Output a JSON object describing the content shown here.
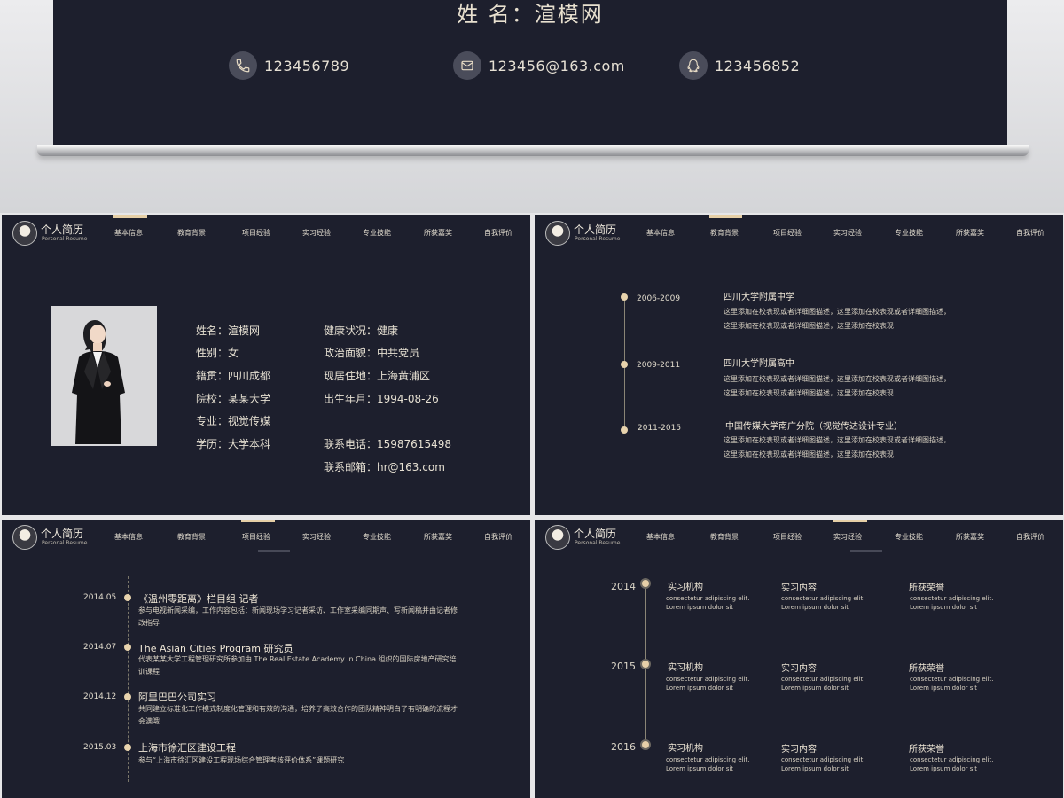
{
  "hero": {
    "name_line": "姓  名：渲模网",
    "phone": "123456789",
    "email": "123456@163.com",
    "qq": "123456852"
  },
  "brand": {
    "title_cn": "个人简历",
    "title_en": "Personal Resume"
  },
  "nav": [
    "基本信息",
    "教育背景",
    "项目经验",
    "实习经验",
    "专业技能",
    "所获嘉奖",
    "自我评价"
  ],
  "basic_info": {
    "left": [
      "姓名：渲模网",
      "性别：女",
      "籍贯：四川成都",
      "院校：某某大学",
      "专业：视觉传媒",
      "学历：大学本科"
    ],
    "right": [
      "健康状况：健康",
      "政治面貌：中共党员",
      "现居住地：上海黄浦区",
      "出生年月：1994-08-26"
    ],
    "phone_label": "联系电话：15987615498",
    "email_label": "联系邮箱：hr@163.com"
  },
  "education": [
    {
      "period": "2006-2009",
      "school": "四川大学附属中学",
      "desc1": "这里添加在校表现或者详细图描述，这里添加在校表现或者详细图描述，",
      "desc2": "这里添加在校表现或者详细图描述，这里添加在校表现"
    },
    {
      "period": "2009-2011",
      "school": "四川大学附属高中",
      "desc1": "这里添加在校表现或者详细图描述，这里添加在校表现或者详细图描述，",
      "desc2": "这里添加在校表现或者详细图描述，这里添加在校表现"
    },
    {
      "period": "2011-2015",
      "school": "中国传媒大学南广分院（视觉传达设计专业）",
      "desc1": "这里添加在校表现或者详细图描述，这里添加在校表现或者详细图描述，",
      "desc2": "这里添加在校表现或者详细图描述，这里添加在校表现"
    }
  ],
  "projects": [
    {
      "date": "2014.05",
      "title": "《温州零距离》栏目组  记者",
      "desc": "参与电视新闻采编，工作内容包括：新闻现场学习记者采访、工作室采编同期声、写新闻稿并由记者修改指导"
    },
    {
      "date": "2014.07",
      "title": "The Asian Cities Program  研究员",
      "desc": "代表某某大学工程管理研究所参加由 The Real Estate Academy in China  组织的国际房地产研究培训课程"
    },
    {
      "date": "2014.12",
      "title": "阿里巴巴公司实习",
      "desc": "共同建立标准化工作模式制度化管理和有效的沟通，培养了高效合作的团队精神明白了有明确的流程才会满哦"
    },
    {
      "date": "2015.03",
      "title": "上海市徐汇区建设工程",
      "desc": "参与“上海市徐汇区建设工程现场综合管理考核评价体系”课题研究"
    }
  ],
  "internship": {
    "years": [
      "2014",
      "2015",
      "2016"
    ],
    "columns": [
      "实习机构",
      "实习内容",
      "所获荣誉"
    ],
    "desc_line1": "consectetur adipiscing elit.",
    "desc_line2": "Lorem ipsum dolor sit"
  },
  "colors": {
    "panel": "#1d1f2d",
    "accent": "#e6cfa6",
    "text": "#e8e2d6"
  },
  "icons": {
    "phone": "phone-icon",
    "email": "mail-icon",
    "qq": "qq-icon"
  }
}
